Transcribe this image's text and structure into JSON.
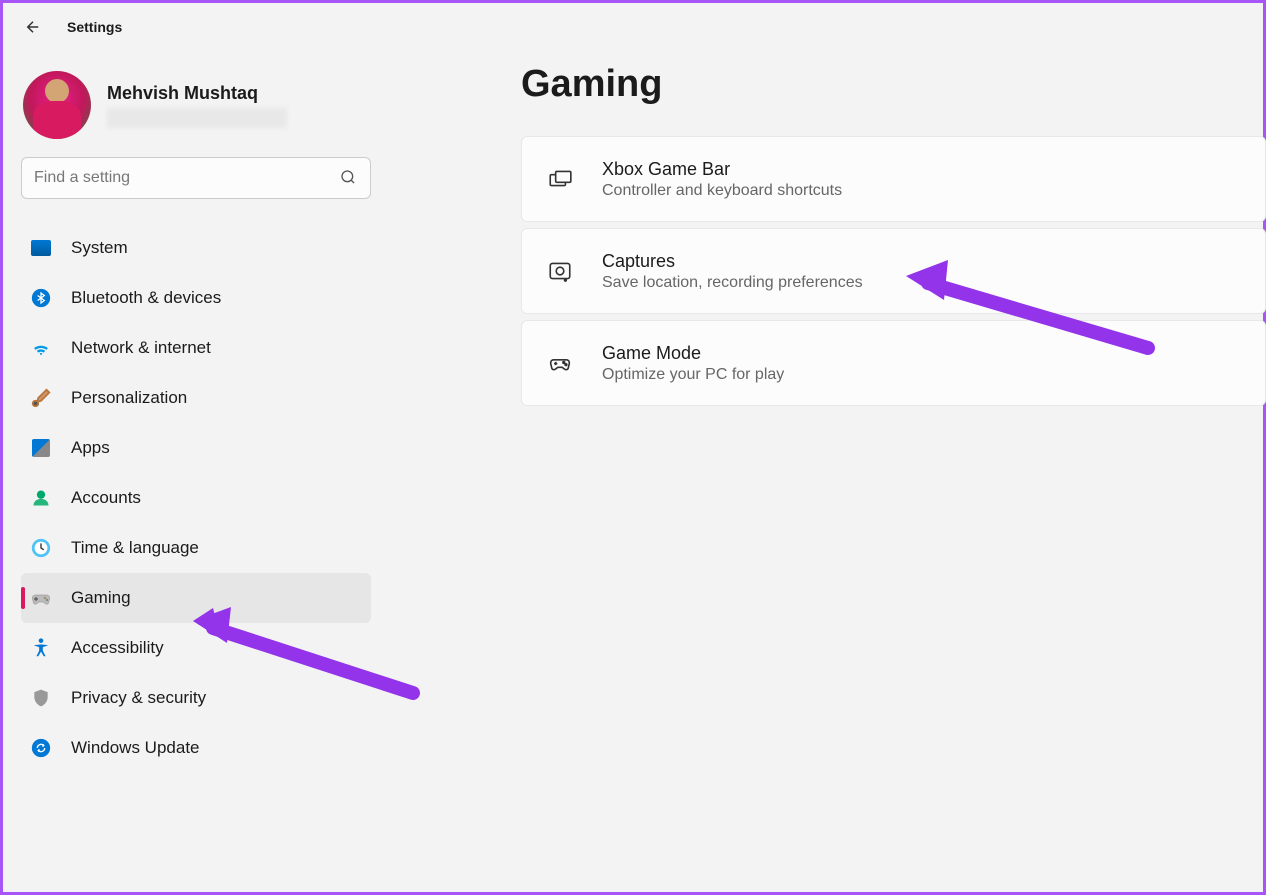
{
  "header": {
    "title": "Settings"
  },
  "user": {
    "name": "Mehvish Mushtaq"
  },
  "search": {
    "placeholder": "Find a setting"
  },
  "sidebar": {
    "items": [
      {
        "label": "System",
        "icon": "system"
      },
      {
        "label": "Bluetooth & devices",
        "icon": "bluetooth"
      },
      {
        "label": "Network & internet",
        "icon": "wifi"
      },
      {
        "label": "Personalization",
        "icon": "brush"
      },
      {
        "label": "Apps",
        "icon": "apps"
      },
      {
        "label": "Accounts",
        "icon": "person"
      },
      {
        "label": "Time & language",
        "icon": "clock"
      },
      {
        "label": "Gaming",
        "icon": "gamepad",
        "active": true
      },
      {
        "label": "Accessibility",
        "icon": "accessibility"
      },
      {
        "label": "Privacy & security",
        "icon": "shield"
      },
      {
        "label": "Windows Update",
        "icon": "update"
      }
    ]
  },
  "main": {
    "title": "Gaming",
    "cards": [
      {
        "title": "Xbox Game Bar",
        "subtitle": "Controller and keyboard shortcuts",
        "icon": "gamebar"
      },
      {
        "title": "Captures",
        "subtitle": "Save location, recording preferences",
        "icon": "captures"
      },
      {
        "title": "Game Mode",
        "subtitle": "Optimize your PC for play",
        "icon": "gamemode"
      }
    ]
  }
}
